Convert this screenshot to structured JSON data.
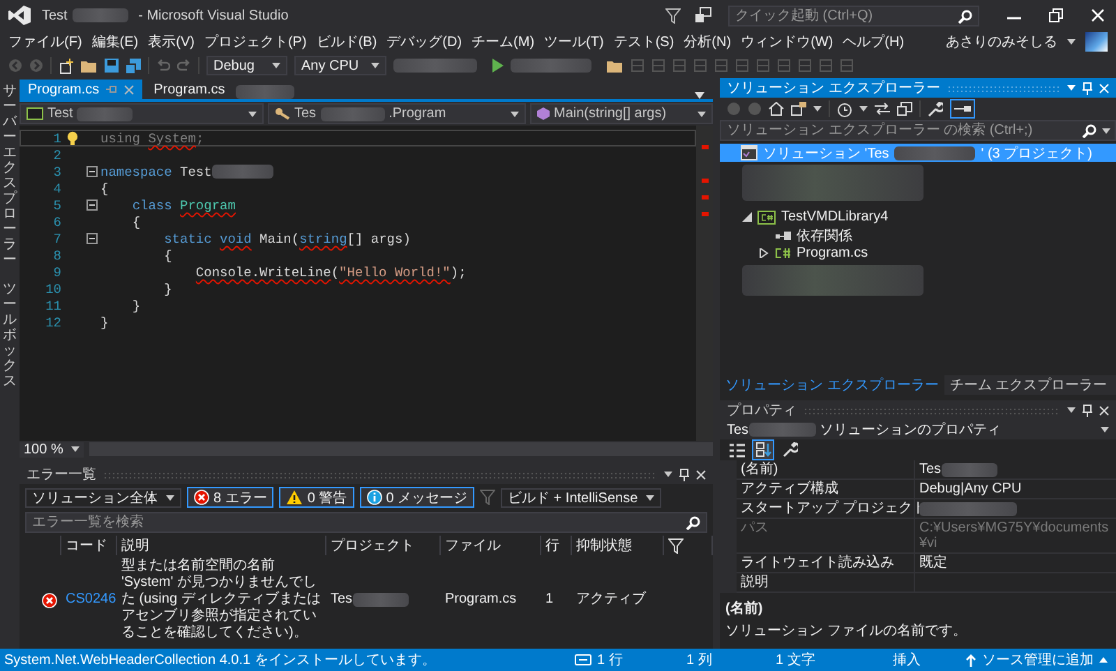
{
  "window": {
    "title": "Test",
    "title_suffix": " - Microsoft Visual Studio"
  },
  "quick_launch": {
    "placeholder": "クイック起動 (Ctrl+Q)"
  },
  "menu": [
    "ファイル(F)",
    "編集(E)",
    "表示(V)",
    "プロジェクト(P)",
    "ビルド(B)",
    "デバッグ(D)",
    "チーム(M)",
    "ツール(T)",
    "テスト(S)",
    "分析(N)",
    "ウィンドウ(W)",
    "ヘルプ(H)"
  ],
  "account": {
    "name": "あさりのみそしる"
  },
  "toolbar": {
    "configuration": "Debug",
    "platform": "Any CPU"
  },
  "side_tabs": [
    {
      "label": "サーバーエクスプローラー"
    },
    {
      "label": "ツールボックス"
    }
  ],
  "editor": {
    "tabs": [
      {
        "label": "Program.cs",
        "selected": true
      },
      {
        "label": "Program.cs",
        "selected": false
      }
    ],
    "navigation": {
      "project": "Test",
      "type_prefix": "Tes",
      "type_suffix": ".Program",
      "member": "Main(string[] args)"
    },
    "lines": [
      {
        "number": "1",
        "current": true,
        "lightbulb": true,
        "fold": false,
        "tokens": [
          {
            "text": "using ",
            "kind": "unused",
            "squiggle": false
          },
          {
            "text": "System",
            "kind": "unused",
            "squiggle": true
          },
          {
            "text": ";",
            "kind": "unused",
            "squiggle": false
          }
        ]
      },
      {
        "number": "2",
        "current": false,
        "lightbulb": false,
        "fold": false
      },
      {
        "number": "3",
        "current": false,
        "lightbulb": false,
        "fold": true,
        "tokens": [
          {
            "text": "namespace",
            "kind": "keyword",
            "squiggle": false
          },
          {
            "text": " Test",
            "kind": "plain",
            "squiggle": false
          },
          {
            "kind": "redacted"
          }
        ]
      },
      {
        "number": "4",
        "current": false,
        "lightbulb": false,
        "fold": false,
        "tokens": [
          {
            "text": "{",
            "kind": "plain",
            "squiggle": false
          }
        ]
      },
      {
        "number": "5",
        "current": false,
        "lightbulb": false,
        "fold": true,
        "tokens": [
          {
            "text": "    class ",
            "kind": "keyword",
            "squiggle": false
          },
          {
            "text": "Program",
            "kind": "type",
            "squiggle": true
          }
        ]
      },
      {
        "number": "6",
        "current": false,
        "lightbulb": false,
        "fold": false,
        "tokens": [
          {
            "text": "    {",
            "kind": "plain",
            "squiggle": false
          }
        ]
      },
      {
        "number": "7",
        "current": false,
        "lightbulb": false,
        "fold": true,
        "tokens": [
          {
            "text": "        static ",
            "kind": "keyword",
            "squiggle": false
          },
          {
            "text": "void",
            "kind": "keyword",
            "squiggle": true
          },
          {
            "text": " Main(",
            "kind": "plain",
            "squiggle": false
          },
          {
            "text": "string",
            "kind": "keyword",
            "squiggle": true
          },
          {
            "text": "[] args)",
            "kind": "plain",
            "squiggle": false
          }
        ]
      },
      {
        "number": "8",
        "current": false,
        "lightbulb": false,
        "fold": false,
        "tokens": [
          {
            "text": "        {",
            "kind": "plain",
            "squiggle": false
          }
        ]
      },
      {
        "number": "9",
        "current": false,
        "lightbulb": false,
        "fold": false,
        "tokens": [
          {
            "text": "            Console.WriteLine",
            "kind": "plain",
            "squiggle": true
          },
          {
            "text": "(",
            "kind": "plain",
            "squiggle": false
          },
          {
            "text": "\"Hello World!\"",
            "kind": "string",
            "squiggle": true
          },
          {
            "text": ");",
            "kind": "plain",
            "squiggle": false
          }
        ]
      },
      {
        "number": "10",
        "current": false,
        "lightbulb": false,
        "fold": false,
        "tokens": [
          {
            "text": "        }",
            "kind": "plain",
            "squiggle": false
          }
        ]
      },
      {
        "number": "11",
        "current": false,
        "lightbulb": false,
        "fold": false,
        "tokens": [
          {
            "text": "    }",
            "kind": "plain",
            "squiggle": false
          }
        ]
      },
      {
        "number": "12",
        "current": false,
        "lightbulb": false,
        "fold": false,
        "tokens": [
          {
            "text": "}",
            "kind": "plain",
            "squiggle": false
          }
        ]
      }
    ],
    "zoom": "100 %"
  },
  "error_list": {
    "title": "エラー一覧",
    "scope": "ソリューション全体",
    "filters": [
      {
        "kind": "error",
        "label": "8 エラー",
        "selected": true
      },
      {
        "kind": "warning",
        "label": "0 警告",
        "selected": true
      },
      {
        "kind": "message",
        "label": "0 メッセージ",
        "selected": true
      }
    ],
    "source": "ビルド + IntelliSense",
    "search_placeholder": "エラー一覧を検索",
    "columns": [
      "コード",
      "説明",
      "プロジェクト",
      "ファイル",
      "行",
      "抑制状態"
    ],
    "rows": [
      {
        "kind": "error",
        "code": "CS0246",
        "description": "型または名前空間の名前 'System' が見つかりませんでした (using ディレクティブまたはアセンブリ参照が指定されていることを確認してください)。",
        "project": "Tes",
        "file": "Program.cs",
        "line": "1",
        "state": "アクティブ"
      }
    ]
  },
  "solution_explorer": {
    "title": "ソリューション エクスプローラー",
    "search_placeholder": "ソリューション エクスプローラー の検索 (Ctrl+;)",
    "tree": [
      {
        "kind": "solution",
        "label": "ソリューション 'Tes",
        "label_suffix": "' (3 プロジェクト)",
        "selected": true,
        "children": [
          {
            "kind": "project",
            "label": "TestVMDLibrary4",
            "selected": false,
            "expanded": true,
            "children": [
              {
                "kind": "dependencies",
                "label": "依存関係",
                "selected": false
              },
              {
                "kind": "csharp",
                "label": "Program.cs",
                "selected": false,
                "expanded": false
              }
            ]
          }
        ]
      }
    ],
    "bottom_tabs": [
      {
        "label": "ソリューション エクスプローラー",
        "selected": true
      },
      {
        "label": "チーム エクスプローラー",
        "selected": false
      }
    ]
  },
  "properties": {
    "title": "プロパティ",
    "object": "Tes",
    "object_suffix": " ソリューションのプロパティ",
    "tools": [
      {
        "kind": "categorized",
        "selected": false
      },
      {
        "kind": "alphabetical",
        "selected": true
      },
      {
        "kind": "pages",
        "selected": false
      }
    ],
    "rows": [
      {
        "name": "(名前)",
        "value": "Tes",
        "blurred": true,
        "disabled": false
      },
      {
        "name": "アクティブ構成",
        "value": "Debug|Any CPU",
        "blurred": false,
        "disabled": false
      },
      {
        "name": "スタートアップ プロジェクト",
        "blurred": true,
        "disabled": false
      },
      {
        "name": "パス",
        "value": "C:¥Users¥MG75Y¥documents¥vi",
        "blurred": false,
        "disabled": true
      },
      {
        "name": "ライトウェイト読み込み",
        "value": "既定",
        "blurred": false,
        "disabled": false
      },
      {
        "name": "説明",
        "blurred": false,
        "disabled": false
      }
    ],
    "description_title": "(名前)",
    "description": "ソリューション ファイルの名前です。"
  },
  "status_bar": {
    "message": "System.Net.WebHeaderCollection 4.0.1 をインストールしています。",
    "line": "1 行",
    "column": "1 列",
    "char": "1 文字",
    "mode": "挿入",
    "source_control": "ソース管理に追加"
  }
}
